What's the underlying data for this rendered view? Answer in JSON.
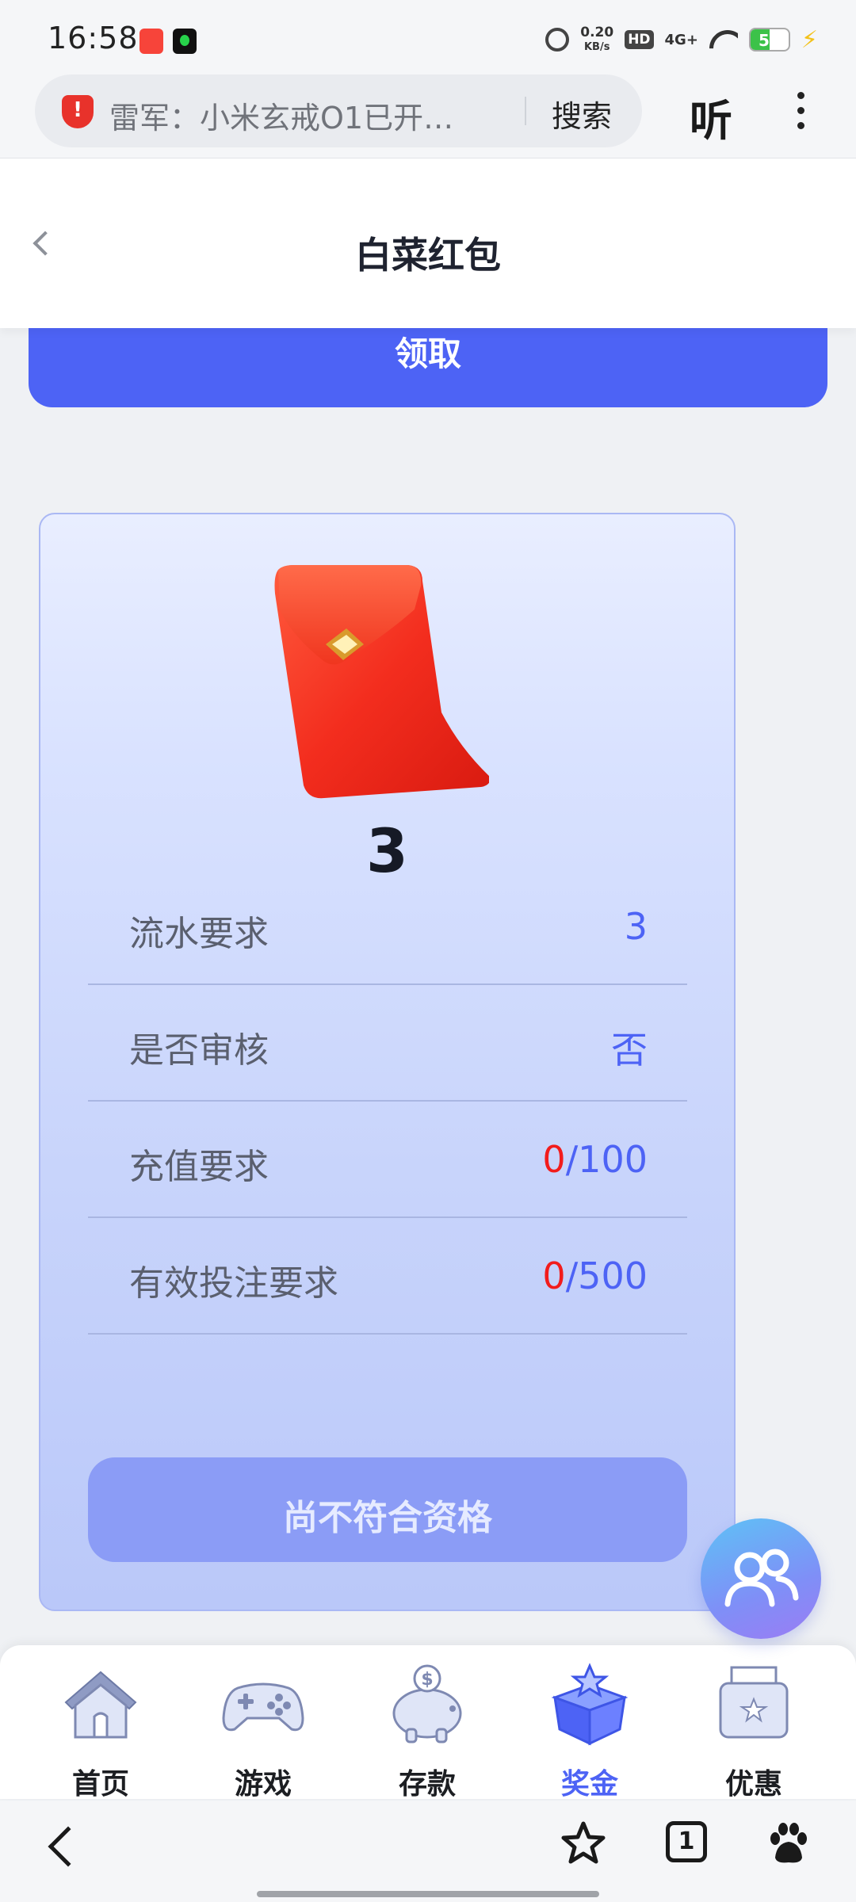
{
  "status_bar": {
    "time": "16:58",
    "net_speed_value": "0.20",
    "net_speed_unit": "KB/s",
    "hd_badge": "HD",
    "network": "4G+",
    "battery_level": "50",
    "battery_fraction": 0.5
  },
  "browser": {
    "url_text": "雷军：小米玄戒O1已开…",
    "search_label": "搜索",
    "listen_label": "听"
  },
  "header": {
    "title": "白菜红包"
  },
  "claim_button": {
    "label": "领取"
  },
  "packet": {
    "amount": "3",
    "requirements": [
      {
        "label": "流水要求",
        "value": "3"
      },
      {
        "label": "是否审核",
        "value": "否"
      },
      {
        "label": "充值要求",
        "current": "0",
        "total": "/100"
      },
      {
        "label": "有效投注要求",
        "current": "0",
        "total": "/500"
      }
    ],
    "status_button": "尚不符合资格"
  },
  "tabbar": {
    "tabs": [
      {
        "label": "首页",
        "icon": "house-icon",
        "active": false
      },
      {
        "label": "游戏",
        "icon": "gamepad-icon",
        "active": false
      },
      {
        "label": "存款",
        "icon": "piggy-bank-icon",
        "active": false
      },
      {
        "label": "奖金",
        "icon": "gift-box-icon",
        "active": true
      },
      {
        "label": "优惠",
        "icon": "coupon-icon",
        "active": false
      }
    ]
  },
  "system_nav": {
    "tab_count": "1"
  },
  "colors": {
    "accent": "#4d63f5",
    "warning_red": "#f21c1c",
    "card_border": "#aab8f4",
    "disabled_button": "#8b9cf6"
  }
}
